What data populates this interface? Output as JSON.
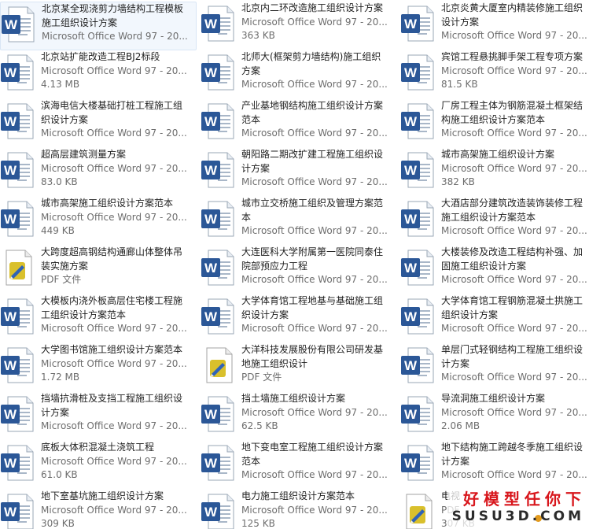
{
  "view": "tiles",
  "file_types": {
    "word": {
      "icon": "word-document-icon",
      "color": "#2b5797"
    },
    "pdf": {
      "icon": "pdf-document-icon",
      "color": "#d9c02c"
    }
  },
  "files": [
    {
      "name": "北京某全现浇剪力墙结构工程模板\n施工组织设计方案",
      "type": "word",
      "line1": "Microsoft Office Word 97 - 20...",
      "line2": "",
      "selected": true
    },
    {
      "name": "北京内二环改造施工组织设计方案",
      "type": "word",
      "line1": "Microsoft Office Word 97 - 20...",
      "line2": "363 KB"
    },
    {
      "name": "北京炎黄大厦室内精装修施工组织\n设计方案",
      "type": "word",
      "line1": "Microsoft Office Word 97 - 20...",
      "line2": ""
    },
    {
      "name": "北京站扩能改造工程BJ2标段",
      "type": "word",
      "line1": "Microsoft Office Word 97 - 20...",
      "line2": "4.13 MB"
    },
    {
      "name": "北师大(框架剪力墙结构)施工组织\n方案",
      "type": "word",
      "line1": "Microsoft Office Word 97 - 20...",
      "line2": ""
    },
    {
      "name": "宾馆工程悬挑脚手架工程专项方案",
      "type": "word",
      "line1": "Microsoft Office Word 97 - 20...",
      "line2": "81.5 KB"
    },
    {
      "name": "滨海电信大楼基础打桩工程施工组\n织设计方案",
      "type": "word",
      "line1": "Microsoft Office Word 97 - 20...",
      "line2": ""
    },
    {
      "name": "产业基地钢结构施工组织设计方案\n范本",
      "type": "word",
      "line1": "Microsoft Office Word 97 - 20...",
      "line2": ""
    },
    {
      "name": "厂房工程主体为钢筋混凝土框架结\n构施工组织设计方案范本",
      "type": "word",
      "line1": "Microsoft Office Word 97 - 20...",
      "line2": ""
    },
    {
      "name": "超高层建筑测量方案",
      "type": "word",
      "line1": "Microsoft Office Word 97 - 20...",
      "line2": "83.0 KB"
    },
    {
      "name": "朝阳路二期改扩建工程施工组织设\n计方案",
      "type": "word",
      "line1": "Microsoft Office Word 97 - 20...",
      "line2": ""
    },
    {
      "name": "城市高架施工组织设计方案",
      "type": "word",
      "line1": "Microsoft Office Word 97 - 20...",
      "line2": "382 KB"
    },
    {
      "name": "城市高架施工组织设计方案范本",
      "type": "word",
      "line1": "Microsoft Office Word 97 - 20...",
      "line2": "449 KB"
    },
    {
      "name": "城市立交桥施工组织及管理方案范\n本",
      "type": "word",
      "line1": "Microsoft Office Word 97 - 20...",
      "line2": ""
    },
    {
      "name": "大酒店部分建筑改造装饰装修工程\n施工组织设计方案范本",
      "type": "word",
      "line1": "Microsoft Office Word 97 - 20...",
      "line2": ""
    },
    {
      "name": "大跨度超高钢结构通廊山体整体吊\n装实施方案",
      "type": "pdf",
      "line1": "PDF 文件",
      "line2": ""
    },
    {
      "name": "大连医科大学附属第一医院同泰住\n院部预应力工程",
      "type": "word",
      "line1": "Microsoft Office Word 97 - 20...",
      "line2": ""
    },
    {
      "name": "大楼装修及改造工程结构补强、加\n固施工组织设计方案",
      "type": "word",
      "line1": "Microsoft Office Word 97 - 20...",
      "line2": ""
    },
    {
      "name": "大模板内浇外板高层住宅楼工程施\n工组织设计方案范本",
      "type": "word",
      "line1": "Microsoft Office Word 97 - 20...",
      "line2": ""
    },
    {
      "name": "大学体育馆工程地基与基础施工组\n织设计方案",
      "type": "word",
      "line1": "Microsoft Office Word 97 - 20...",
      "line2": ""
    },
    {
      "name": "大学体育馆工程钢筋混凝土拱施工\n组织设计方案",
      "type": "word",
      "line1": "Microsoft Office Word 97 - 20...",
      "line2": ""
    },
    {
      "name": "大学图书馆施工组织设计方案范本",
      "type": "word",
      "line1": "Microsoft Office Word 97 - 20...",
      "line2": "1.72 MB"
    },
    {
      "name": "大洋科技发展股份有限公司研发基\n地施工组织设计",
      "type": "pdf",
      "line1": "PDF 文件",
      "line2": ""
    },
    {
      "name": "单层门式轻钢结构工程施工组织设\n计方案",
      "type": "word",
      "line1": "Microsoft Office Word 97 - 20...",
      "line2": ""
    },
    {
      "name": "挡墙抗滑桩及支挡工程施工组织设\n计方案",
      "type": "word",
      "line1": "Microsoft Office Word 97 - 20...",
      "line2": ""
    },
    {
      "name": "挡土墙施工组织设计方案",
      "type": "word",
      "line1": "Microsoft Office Word 97 - 20...",
      "line2": "62.5 KB"
    },
    {
      "name": "导流洞施工组织设计方案",
      "type": "word",
      "line1": "Microsoft Office Word 97 - 20...",
      "line2": "2.06 MB"
    },
    {
      "name": "底板大体积混凝土浇筑工程",
      "type": "word",
      "line1": "Microsoft Office Word 97 - 20...",
      "line2": "61.0 KB"
    },
    {
      "name": "地下变电室工程施工组织设计方案\n范本",
      "type": "word",
      "line1": "Microsoft Office Word 97 - 20...",
      "line2": ""
    },
    {
      "name": "地下结构施工跨越冬季施工组织设\n计方案",
      "type": "word",
      "line1": "Microsoft Office Word 97 - 20...",
      "line2": ""
    },
    {
      "name": "地下室基坑施工组织设计方案",
      "type": "word",
      "line1": "Microsoft Office Word 97 - 20...",
      "line2": "309 KB"
    },
    {
      "name": "电力施工组织设计方案范本",
      "type": "word",
      "line1": "Microsoft Office Word 97 - 20...",
      "line2": "125 KB"
    },
    {
      "name": "电视",
      "type": "pdf",
      "line1": "PDF",
      "line2": "307 KB"
    }
  ],
  "watermark": {
    "top": "好模型任你下",
    "bottom": "SUSU3D.COM"
  }
}
